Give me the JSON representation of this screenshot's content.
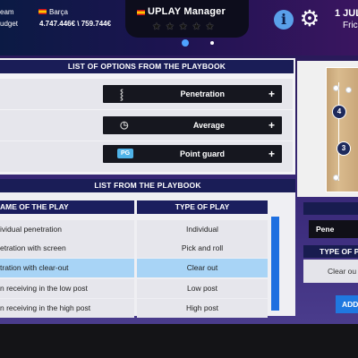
{
  "header": {
    "team_label": "eam",
    "budget_label": "udget",
    "club": "Barça",
    "money": "4.747.446€ \\ 759.744€",
    "manager": "UPLAY Manager",
    "stars": "★★★★★",
    "date": "1 JUL",
    "day": "Fric"
  },
  "options": {
    "title": "LIST OF OPTIONS FROM THE PLAYBOOK",
    "items": [
      {
        "label": "Penetration",
        "icon": "dribble-icon"
      },
      {
        "label": "Average",
        "icon": "stopwatch-icon"
      },
      {
        "label": "Point guard",
        "badge": "PG"
      }
    ],
    "plus": "+"
  },
  "playbook": {
    "title": "LIST FROM THE PLAYBOOK",
    "col_name": "AME OF THE PLAY",
    "col_type": "TYPE OF PLAY",
    "rows": [
      {
        "name": "ividual penetration",
        "type": "Individual"
      },
      {
        "name": "etration with screen",
        "type": "Pick and roll"
      },
      {
        "name": "tration with clear-out",
        "type": "Clear out"
      },
      {
        "name": "n receiving in the low post",
        "type": "Low post"
      },
      {
        "name": "n receiving in the high post",
        "type": "High post"
      }
    ]
  },
  "court": {
    "players": [
      "4",
      "3"
    ]
  },
  "right_panel": {
    "selected_value": "Pene",
    "type_header": "TYPE OF P",
    "type_value": "Clear ou",
    "add_label": "ADD"
  },
  "colors": {
    "header_bg": "#1a1d57",
    "selected_row": "#a8d4f6",
    "accent": "#1f78e0"
  }
}
